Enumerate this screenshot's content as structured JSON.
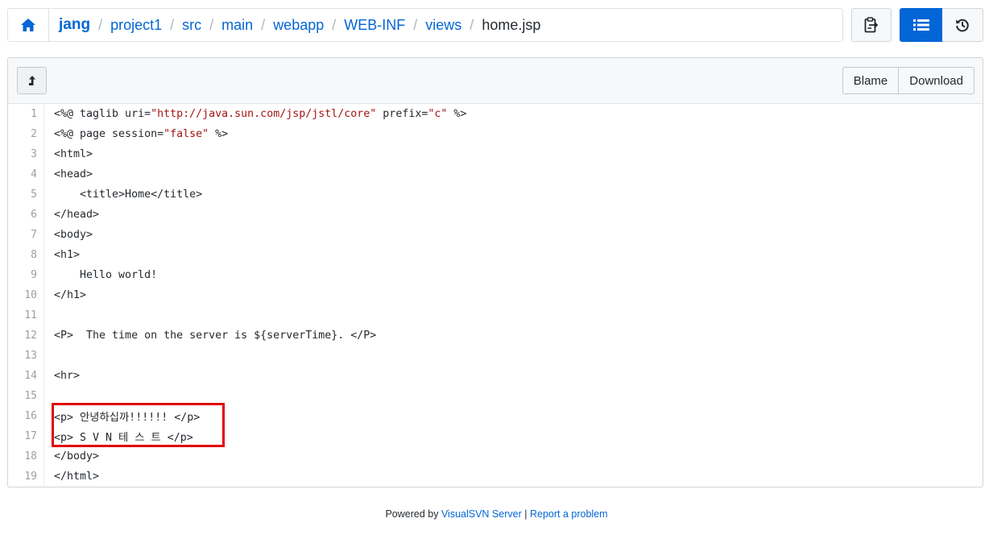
{
  "breadcrumb": {
    "home_icon": "home-icon",
    "items": [
      {
        "label": "jang"
      },
      {
        "label": "project1"
      },
      {
        "label": "src"
      },
      {
        "label": "main"
      },
      {
        "label": "webapp"
      },
      {
        "label": "WEB-INF"
      },
      {
        "label": "views"
      },
      {
        "label": "home.jsp"
      }
    ],
    "separator": "/"
  },
  "toolbar": {
    "clipboard_icon": "clipboard-icon",
    "list_icon": "list-icon",
    "history_icon": "history-icon"
  },
  "file": {
    "up_icon": "level-up-icon",
    "blame_label": "Blame",
    "download_label": "Download",
    "lines": [
      {
        "n": "1",
        "segs": [
          {
            "t": "<%@ taglib uri="
          },
          {
            "t": "\"http://java.sun.com/jsp/jstl/core\"",
            "s": 1
          },
          {
            "t": " prefix="
          },
          {
            "t": "\"c\"",
            "s": 1
          },
          {
            "t": " %>"
          }
        ]
      },
      {
        "n": "2",
        "segs": [
          {
            "t": "<%@ page session="
          },
          {
            "t": "\"false\"",
            "s": 1
          },
          {
            "t": " %>"
          }
        ]
      },
      {
        "n": "3",
        "segs": [
          {
            "t": "<html>"
          }
        ]
      },
      {
        "n": "4",
        "segs": [
          {
            "t": "<head>"
          }
        ]
      },
      {
        "n": "5",
        "segs": [
          {
            "t": "    <title>Home</title>"
          }
        ]
      },
      {
        "n": "6",
        "segs": [
          {
            "t": "</head>"
          }
        ]
      },
      {
        "n": "7",
        "segs": [
          {
            "t": "<body>"
          }
        ]
      },
      {
        "n": "8",
        "segs": [
          {
            "t": "<h1>"
          }
        ]
      },
      {
        "n": "9",
        "segs": [
          {
            "t": "    Hello world!"
          }
        ]
      },
      {
        "n": "10",
        "segs": [
          {
            "t": "</h1>"
          }
        ]
      },
      {
        "n": "11",
        "segs": [
          {
            "t": ""
          }
        ]
      },
      {
        "n": "12",
        "segs": [
          {
            "t": "<P>  The time on the server is ${serverTime}. </P>"
          }
        ]
      },
      {
        "n": "13",
        "segs": [
          {
            "t": ""
          }
        ]
      },
      {
        "n": "14",
        "segs": [
          {
            "t": "<hr>"
          }
        ]
      },
      {
        "n": "15",
        "segs": [
          {
            "t": ""
          }
        ]
      },
      {
        "n": "16",
        "segs": [
          {
            "t": "<p> 안녕하십까!!!!!! </p>"
          }
        ]
      },
      {
        "n": "17",
        "segs": [
          {
            "t": "<p> S V N 테 스 트 </p>"
          }
        ]
      },
      {
        "n": "18",
        "segs": [
          {
            "t": "</body>"
          }
        ]
      },
      {
        "n": "19",
        "segs": [
          {
            "t": "</html>"
          }
        ]
      }
    ]
  },
  "footer": {
    "powered_by": "Powered by",
    "product_link": "VisualSVN Server",
    "divider": "|",
    "report_link": "Report a problem"
  },
  "colors": {
    "link": "#0366d6",
    "primary_button": "#0366d6",
    "string": "#a31515",
    "highlight_box": "#e00000"
  }
}
